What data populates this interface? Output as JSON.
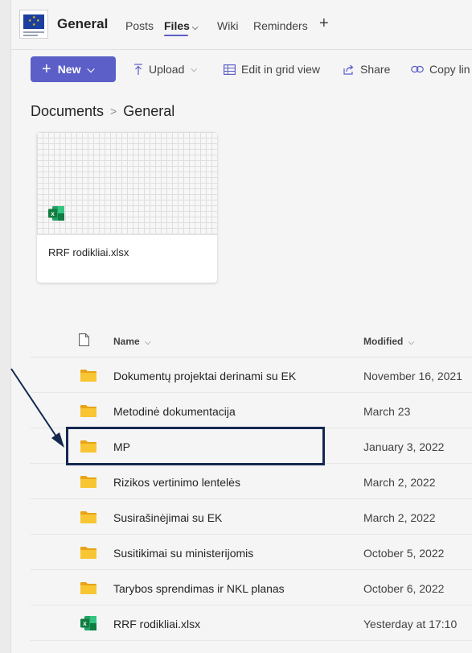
{
  "header": {
    "channel_name": "General",
    "tabs": [
      {
        "label": "Posts"
      },
      {
        "label": "Files"
      },
      {
        "label": "Wiki"
      },
      {
        "label": "Reminders"
      }
    ]
  },
  "toolbar": {
    "new_label": "New",
    "upload_label": "Upload",
    "grid_label": "Edit in grid view",
    "share_label": "Share",
    "copy_link_label": "Copy lin"
  },
  "breadcrumb": {
    "root": "Documents",
    "current": "General"
  },
  "tile": {
    "file_name": "RRF rodikliai.xlsx"
  },
  "list": {
    "name_header": "Name",
    "modified_header": "Modified",
    "rows": [
      {
        "name": "Dokumentų projektai derinami su EK",
        "modified": "November 16, 2021",
        "type": "folder"
      },
      {
        "name": "Metodinė dokumentacija",
        "modified": "March 23",
        "type": "folder"
      },
      {
        "name": "MP",
        "modified": "January 3, 2022",
        "type": "folder"
      },
      {
        "name": "Rizikos vertinimo lentelės",
        "modified": "March 2, 2022",
        "type": "folder"
      },
      {
        "name": "Susirašinėjimai su EK",
        "modified": "March 2, 2022",
        "type": "folder"
      },
      {
        "name": "Susitikimai su ministerijomis",
        "modified": "October 5, 2022",
        "type": "folder"
      },
      {
        "name": "Tarybos sprendimas ir NKL planas",
        "modified": "October 6, 2022",
        "type": "folder"
      },
      {
        "name": "RRF rodikliai.xlsx",
        "modified": "Yesterday at 17:10",
        "type": "excel"
      }
    ]
  },
  "colors": {
    "accent": "#5b5fc7",
    "folder": "#f8c533",
    "excel": "#107c41",
    "annotation": "#142850"
  },
  "icons": [
    "team-logo",
    "plus-icon",
    "chevron-down-icon",
    "upload-icon",
    "grid-icon",
    "share-icon",
    "link-icon",
    "file-icon",
    "folder-icon",
    "excel-icon",
    "arrow-annotation"
  ]
}
